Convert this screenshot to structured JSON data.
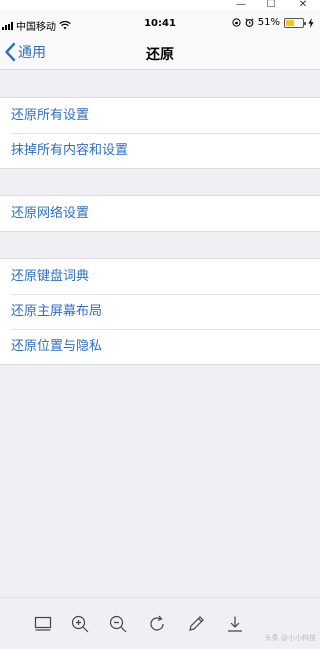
{
  "window_controls": {
    "minimize": "—",
    "maximize": "☐",
    "close": "✕"
  },
  "status_bar": {
    "carrier": "中国移动",
    "time": "10:41",
    "battery_percent": "51%",
    "battery_level": 0.51,
    "battery_color": "#f5c518"
  },
  "nav": {
    "back_label": "通用",
    "title": "还原"
  },
  "groups": [
    {
      "items": [
        "还原所有设置",
        "抹掉所有内容和设置"
      ]
    },
    {
      "items": [
        "还原网络设置"
      ]
    },
    {
      "items": [
        "还原键盘词典",
        "还原主屏幕布局",
        "还原位置与隐私"
      ]
    }
  ],
  "toolbar": {
    "icons": [
      "fit-screen-icon",
      "zoom-in-icon",
      "zoom-out-icon",
      "rotate-icon",
      "edit-icon",
      "download-icon"
    ]
  },
  "watermark": "头条 @小小科技",
  "colors": {
    "accent": "#2f6fbf",
    "background": "#efeff4"
  }
}
